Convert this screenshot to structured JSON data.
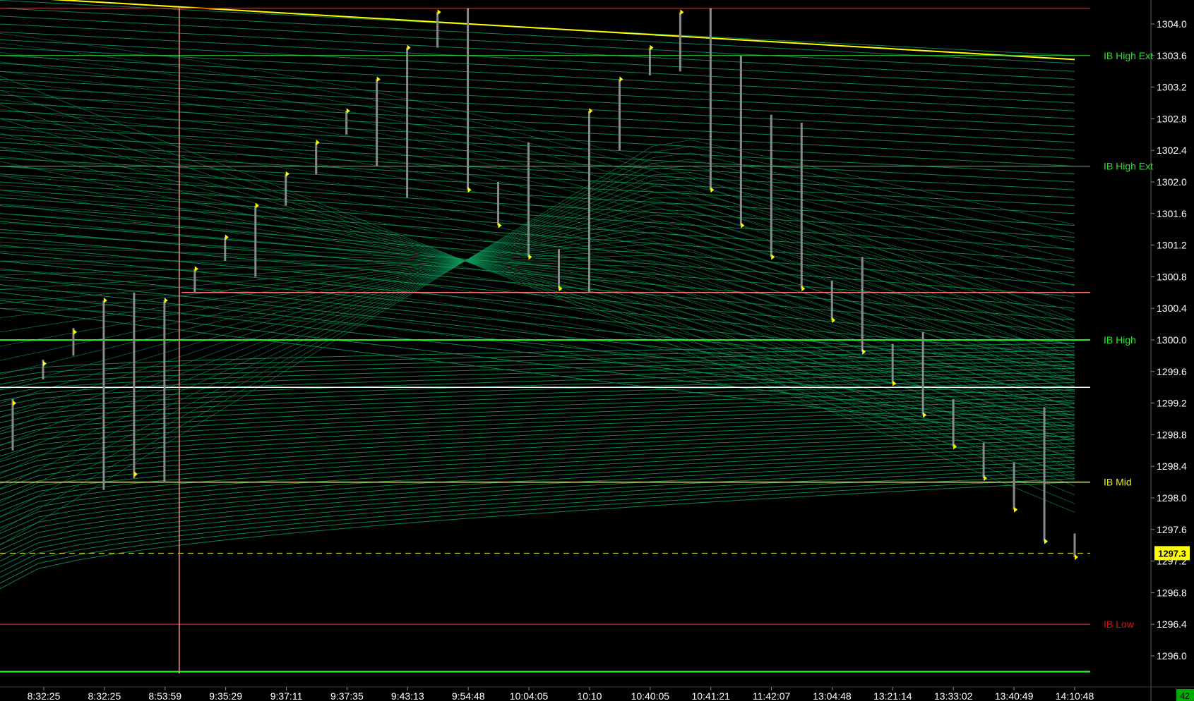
{
  "chart_data": {
    "type": "ohlc-bars",
    "y_axis": {
      "range": [
        1295.75,
        1304.25
      ],
      "ticks": [
        "1304.0",
        "1303.6",
        "1303.2",
        "1302.8",
        "1302.4",
        "1302.0",
        "1301.6",
        "1301.2",
        "1300.8",
        "1300.4",
        "1300.0",
        "1299.6",
        "1299.2",
        "1298.8",
        "1298.4",
        "1298.0",
        "1297.6",
        "1297.2",
        "1296.8",
        "1296.4",
        "1296.0"
      ]
    },
    "x_axis": {
      "labels": [
        "8:32:25",
        "8:32:25",
        "8:53:59",
        "9:35:29",
        "9:37:11",
        "9:37:35",
        "9:43:13",
        "9:54:48",
        "10:04:05",
        "10:10",
        "10:40:05",
        "10:41:21",
        "11:42:07",
        "13:04:48",
        "13:21:14",
        "13:33:02",
        "13:40:49",
        "14:10:48"
      ]
    },
    "bars": [
      {
        "high": 1299.25,
        "low": 1298.6,
        "close": 1299.2
      },
      {
        "high": 1299.75,
        "low": 1299.5,
        "close": 1299.7
      },
      {
        "high": 1300.15,
        "low": 1299.8,
        "close": 1300.1
      },
      {
        "high": 1300.5,
        "low": 1298.1,
        "close": 1300.5
      },
      {
        "high": 1300.6,
        "low": 1298.25,
        "close": 1298.3
      },
      {
        "high": 1300.5,
        "low": 1298.2,
        "close": 1300.5
      },
      {
        "high": 1300.9,
        "low": 1300.6,
        "close": 1300.9
      },
      {
        "high": 1301.3,
        "low": 1301.0,
        "close": 1301.3
      },
      {
        "high": 1301.7,
        "low": 1300.8,
        "close": 1301.7
      },
      {
        "high": 1302.1,
        "low": 1301.7,
        "close": 1302.1
      },
      {
        "high": 1302.5,
        "low": 1302.1,
        "close": 1302.5
      },
      {
        "high": 1302.9,
        "low": 1302.6,
        "close": 1302.9
      },
      {
        "high": 1303.3,
        "low": 1302.2,
        "close": 1303.3
      },
      {
        "high": 1303.7,
        "low": 1301.8,
        "close": 1303.7
      },
      {
        "high": 1304.15,
        "low": 1303.7,
        "close": 1304.15
      },
      {
        "high": 1304.2,
        "low": 1301.9,
        "close": 1301.9
      },
      {
        "high": 1302.0,
        "low": 1301.45,
        "close": 1301.45
      },
      {
        "high": 1302.5,
        "low": 1301.05,
        "close": 1301.05
      },
      {
        "high": 1301.15,
        "low": 1300.65,
        "close": 1300.65
      },
      {
        "high": 1302.9,
        "low": 1300.6,
        "close": 1302.9
      },
      {
        "high": 1303.3,
        "low": 1302.4,
        "close": 1303.3
      },
      {
        "high": 1303.7,
        "low": 1303.35,
        "close": 1303.7
      },
      {
        "high": 1304.15,
        "low": 1303.4,
        "close": 1304.15
      },
      {
        "high": 1304.2,
        "low": 1301.9,
        "close": 1301.9
      },
      {
        "high": 1303.6,
        "low": 1301.45,
        "close": 1301.45
      },
      {
        "high": 1302.85,
        "low": 1301.05,
        "close": 1301.05
      },
      {
        "high": 1302.75,
        "low": 1300.65,
        "close": 1300.65
      },
      {
        "high": 1300.75,
        "low": 1300.25,
        "close": 1300.25
      },
      {
        "high": 1301.05,
        "low": 1299.85,
        "close": 1299.85
      },
      {
        "high": 1299.95,
        "low": 1299.45,
        "close": 1299.45
      },
      {
        "high": 1300.1,
        "low": 1299.05,
        "close": 1299.05
      },
      {
        "high": 1299.25,
        "low": 1298.65,
        "close": 1298.65
      },
      {
        "high": 1298.7,
        "low": 1298.25,
        "close": 1298.25
      },
      {
        "high": 1298.45,
        "low": 1297.85,
        "close": 1297.85
      },
      {
        "high": 1299.15,
        "low": 1297.45,
        "close": 1297.45
      },
      {
        "high": 1297.55,
        "low": 1297.25,
        "close": 1297.25
      }
    ],
    "levels": [
      {
        "price": 1304.2,
        "color": "#dd1111",
        "label": "",
        "width": 1.5,
        "dash": "",
        "x_start": 0
      },
      {
        "price": 1303.6,
        "color": "#33dd33",
        "label": "IB High Ext",
        "width": 1,
        "dash": "",
        "x_start": 0
      },
      {
        "price": 1302.2,
        "color": "#33dd33",
        "label": "IB High Ext",
        "width": 1,
        "dash": "",
        "x_start": 0
      },
      {
        "price": 1300.6,
        "color": "#ff7070",
        "label": "",
        "width": 1.5,
        "dash": "",
        "x_start": 0.1667
      },
      {
        "price": 1300.0,
        "color": "#22ee22",
        "label": "IB High",
        "width": 2,
        "dash": "",
        "x_start": 0
      },
      {
        "price": 1299.4,
        "color": "#ffffff",
        "label": "",
        "width": 1.5,
        "dash": "",
        "x_start": 0
      },
      {
        "price": 1298.2,
        "color": "#eeee22",
        "label": "IB Mid",
        "width": 1.5,
        "dash": "",
        "x_start": 0
      },
      {
        "price": 1297.3,
        "color": "#eeee22",
        "label": "",
        "width": 1,
        "dash": "8,6",
        "x_start": 0
      },
      {
        "price": 1296.4,
        "color": "#dd1111",
        "label": "IB Low",
        "width": 1.5,
        "dash": "",
        "x_start": 0
      },
      {
        "price": 1295.8,
        "color": "#22ee22",
        "label": "",
        "width": 2.5,
        "dash": "",
        "x_start": 0
      }
    ],
    "vertical_marker_bar_index": 6,
    "current_price": "1297.3",
    "corner_badge": "42",
    "colors": {
      "background": "#000000",
      "bar": "#8a8a8a",
      "close_tick": "#ffff00",
      "ribbon": "#0d9a5a",
      "yellow_curve": "#ffff00",
      "vertical_marker": "#ff8a8a",
      "badge_bg": "#00aa00"
    }
  }
}
